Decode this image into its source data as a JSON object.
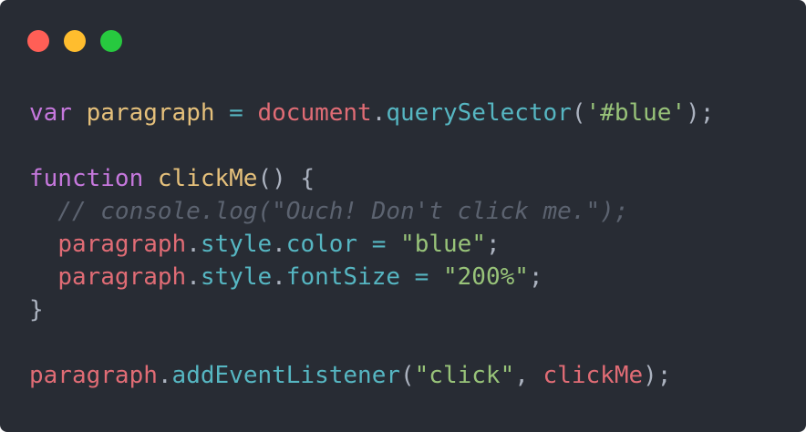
{
  "window": {
    "background": "#282c34",
    "buttons": [
      {
        "name": "close",
        "color": "#ff5f56"
      },
      {
        "name": "minimize",
        "color": "#ffbd2e"
      },
      {
        "name": "maximize",
        "color": "#27c93f"
      }
    ]
  },
  "code": {
    "language": "javascript",
    "colors": {
      "keyword": "#c678dd",
      "variable": "#e5c07b",
      "object": "#e06c75",
      "method": "#56b6c2",
      "string": "#98c379",
      "punctuation": "#abb2bf",
      "comment": "#5c6370"
    },
    "lines": [
      [
        {
          "t": "var",
          "c": "keyword"
        },
        {
          "t": " ",
          "c": "punctuation"
        },
        {
          "t": "paragraph",
          "c": "variable"
        },
        {
          "t": " = ",
          "c": "method"
        },
        {
          "t": "document",
          "c": "object"
        },
        {
          "t": ".",
          "c": "punctuation"
        },
        {
          "t": "querySelector",
          "c": "method"
        },
        {
          "t": "(",
          "c": "punctuation"
        },
        {
          "t": "'#blue'",
          "c": "string"
        },
        {
          "t": ");",
          "c": "punctuation"
        }
      ],
      [],
      [
        {
          "t": "function",
          "c": "keyword"
        },
        {
          "t": " ",
          "c": "punctuation"
        },
        {
          "t": "clickMe",
          "c": "variable"
        },
        {
          "t": "() {",
          "c": "punctuation"
        }
      ],
      [
        {
          "t": "  // console.log(\"Ouch! Don't click me.\");",
          "c": "comment",
          "i": true
        }
      ],
      [
        {
          "t": "  ",
          "c": "punctuation"
        },
        {
          "t": "paragraph",
          "c": "object"
        },
        {
          "t": ".",
          "c": "punctuation"
        },
        {
          "t": "style",
          "c": "method"
        },
        {
          "t": ".",
          "c": "punctuation"
        },
        {
          "t": "color",
          "c": "method"
        },
        {
          "t": " = ",
          "c": "method"
        },
        {
          "t": "\"blue\"",
          "c": "string"
        },
        {
          "t": ";",
          "c": "punctuation"
        }
      ],
      [
        {
          "t": "  ",
          "c": "punctuation"
        },
        {
          "t": "paragraph",
          "c": "object"
        },
        {
          "t": ".",
          "c": "punctuation"
        },
        {
          "t": "style",
          "c": "method"
        },
        {
          "t": ".",
          "c": "punctuation"
        },
        {
          "t": "fontSize",
          "c": "method"
        },
        {
          "t": " = ",
          "c": "method"
        },
        {
          "t": "\"200%\"",
          "c": "string"
        },
        {
          "t": ";",
          "c": "punctuation"
        }
      ],
      [
        {
          "t": "}",
          "c": "punctuation"
        }
      ],
      [],
      [
        {
          "t": "paragraph",
          "c": "object"
        },
        {
          "t": ".",
          "c": "punctuation"
        },
        {
          "t": "addEventListener",
          "c": "method"
        },
        {
          "t": "(",
          "c": "punctuation"
        },
        {
          "t": "\"click\"",
          "c": "string"
        },
        {
          "t": ", ",
          "c": "punctuation"
        },
        {
          "t": "clickMe",
          "c": "object"
        },
        {
          "t": ");",
          "c": "punctuation"
        }
      ]
    ]
  }
}
